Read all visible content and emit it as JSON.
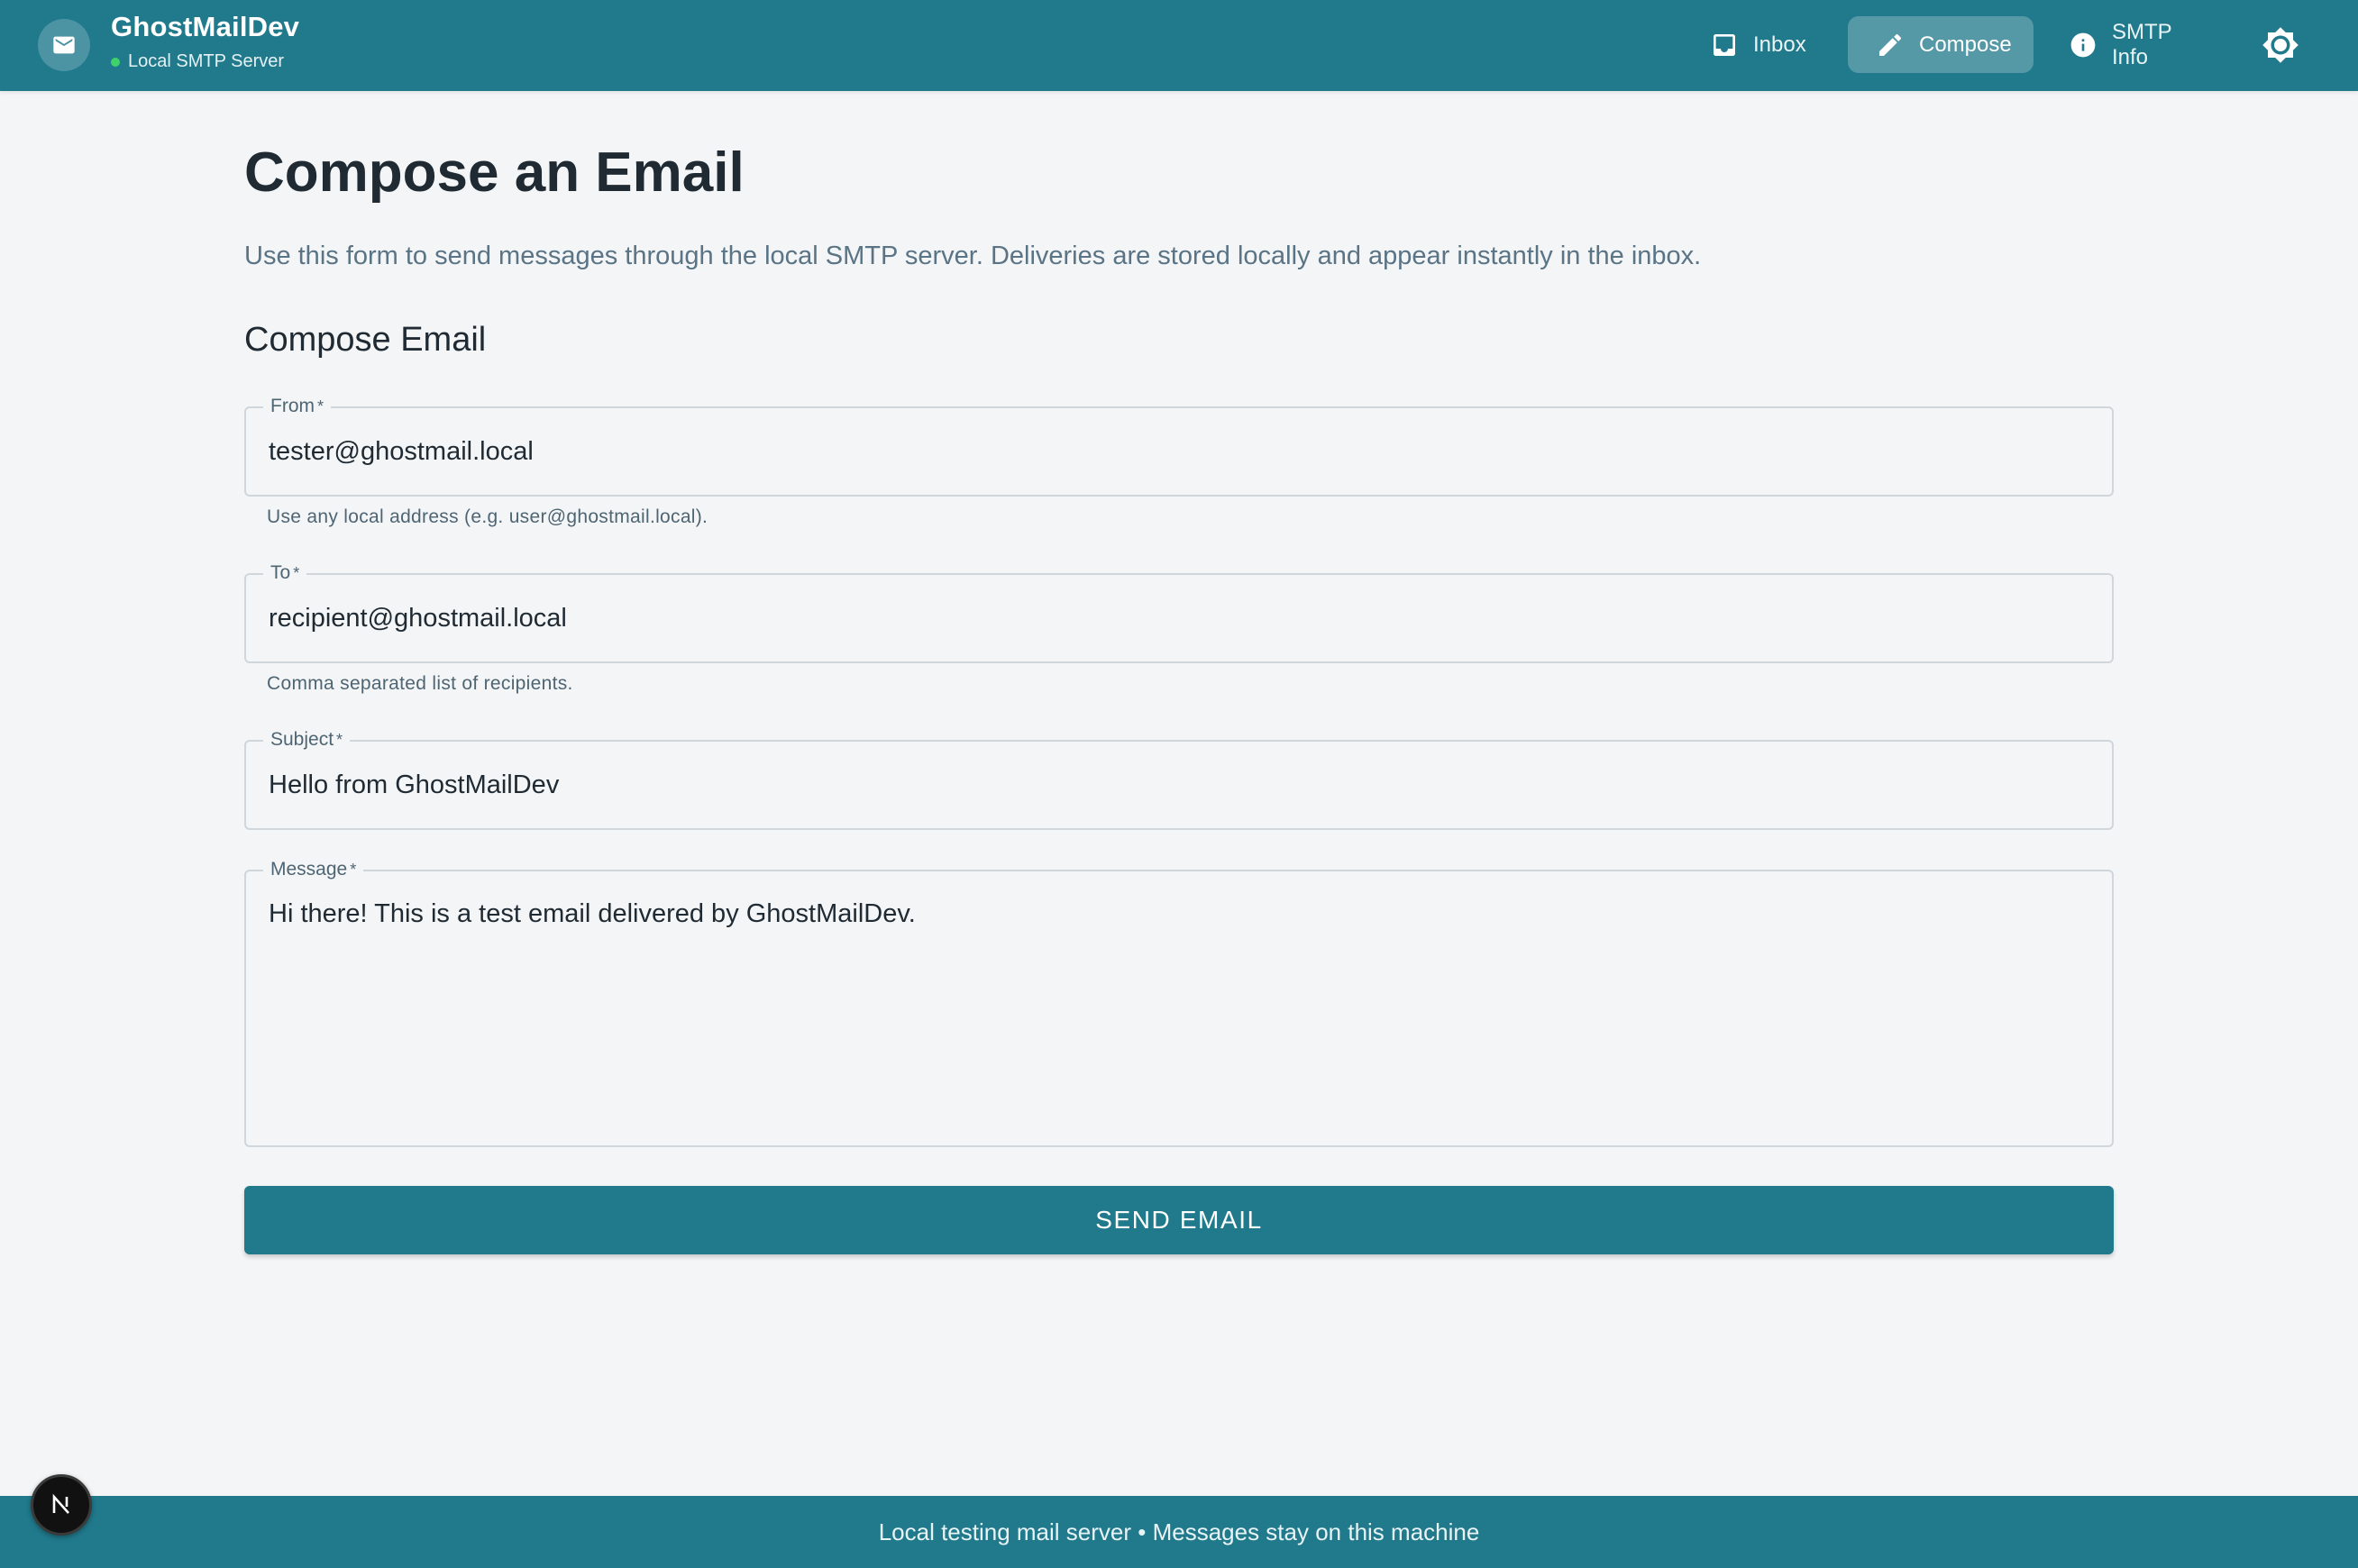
{
  "header": {
    "app_name": "GhostMailDev",
    "status_text": "Local SMTP Server",
    "nav": [
      {
        "label": "Inbox",
        "icon": "inbox-icon",
        "active": false
      },
      {
        "label": "Compose",
        "icon": "pencil-icon",
        "active": true
      },
      {
        "label": "SMTP Info",
        "icon": "info-icon",
        "active": false
      }
    ],
    "theme_toggle_icon": "sun-icon"
  },
  "main": {
    "title": "Compose an Email",
    "description": "Use this form to send messages through the local SMTP server. Deliveries are stored locally and appear instantly in the inbox.",
    "form_title": "Compose Email",
    "fields": {
      "from": {
        "label": "From",
        "required_mark": "*",
        "value": "tester@ghostmail.local",
        "helper": "Use any local address (e.g. user@ghostmail.local)."
      },
      "to": {
        "label": "To",
        "required_mark": "*",
        "value": "recipient@ghostmail.local",
        "helper": "Comma separated list of recipients."
      },
      "subject": {
        "label": "Subject",
        "required_mark": "*",
        "value": "Hello from GhostMailDev"
      },
      "message": {
        "label": "Message",
        "required_mark": "*",
        "value": "Hi there! This is a test email delivered by GhostMailDev."
      }
    },
    "send_label": "SEND EMAIL"
  },
  "footer": {
    "text": "Local testing mail server • Messages stay on this machine"
  },
  "dev_badge": {
    "letter": "N"
  },
  "colors": {
    "primary": "#207a8c",
    "background": "#f4f5f7",
    "status_online": "#3fd26a"
  }
}
